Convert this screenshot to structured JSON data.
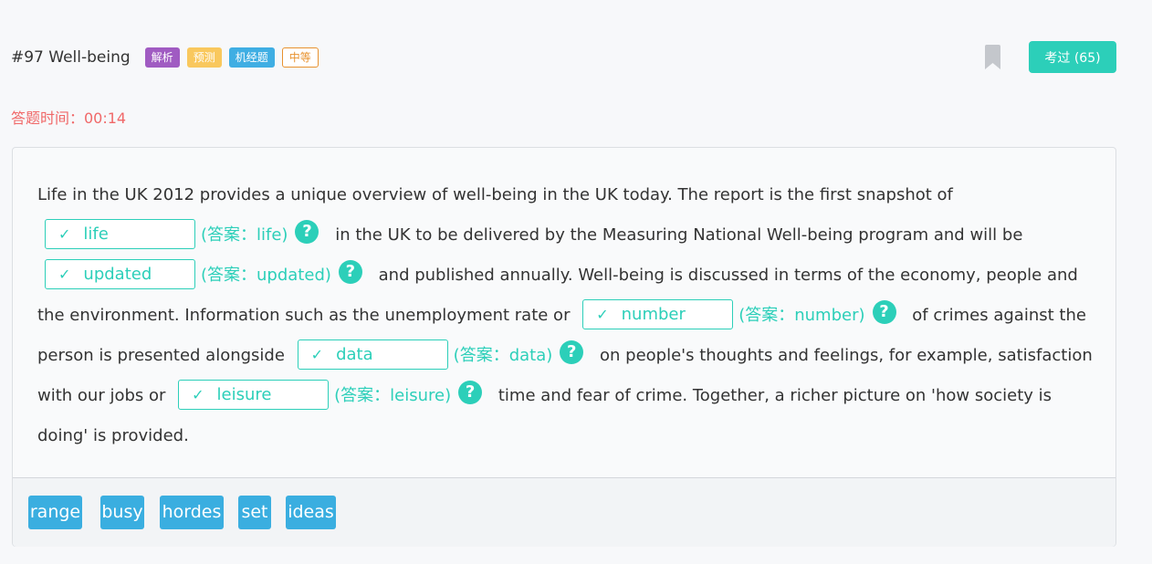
{
  "question": {
    "title": "#97 Well-being",
    "tags": [
      "解析",
      "预测",
      "机经题",
      "中等"
    ],
    "test_button": "考过 (65)",
    "timer": "答题时间：00:14"
  },
  "passage": {
    "seg0": "Life in the UK 2012 provides a unique overview of well-being in the UK today. The report is the first snapshot of",
    "seg1": "in the UK to be delivered by the Measuring National Well-being program and will be",
    "seg2": "and published annually. Well-being is discussed in terms of the economy, people and the environment. Information such as the unemployment rate or",
    "seg3": "of crimes against the person is presented alongside",
    "seg4": "on people's thoughts and feelings, for example, satisfaction with our jobs or",
    "seg5": "time and fear of crime. Together, a richer picture on 'how society is doing' is provided."
  },
  "blanks": [
    {
      "value": "life",
      "answer": "(答案：life)"
    },
    {
      "value": "updated",
      "answer": "(答案：updated)"
    },
    {
      "value": "number",
      "answer": "(答案：number)"
    },
    {
      "value": "data",
      "answer": "(答案：data)"
    },
    {
      "value": "leisure",
      "answer": "(答案：leisure)"
    }
  ],
  "icons": {
    "check": "✓",
    "help": "?",
    "bookmark": "bookmark-icon"
  },
  "word_bank": [
    "range",
    "busy",
    "hordes",
    "set",
    "ideas"
  ],
  "colors": {
    "accent": "#2ccfb9",
    "timer": "#f06868",
    "word_bank": "#3aaee0"
  }
}
